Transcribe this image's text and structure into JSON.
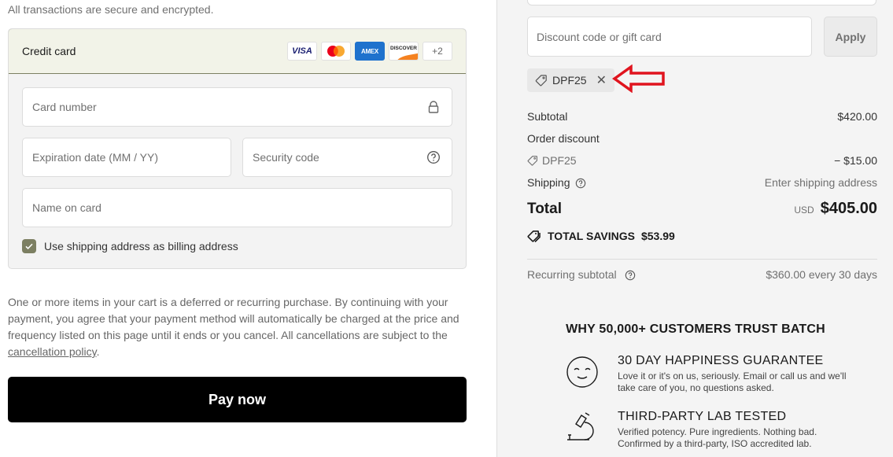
{
  "payment": {
    "secure_note": "All transactions are secure and encrypted.",
    "method_label": "Credit card",
    "card_brands": [
      "VISA",
      "Mastercard",
      "AMEX",
      "DISCOVER"
    ],
    "more_brands": "+2",
    "fields": {
      "card_number_placeholder": "Card number",
      "expiration_placeholder": "Expiration date (MM / YY)",
      "security_code_placeholder": "Security code",
      "name_placeholder": "Name on card"
    },
    "billing_checkbox_label": "Use shipping address as billing address",
    "billing_checkbox_checked": true,
    "accent_color": "#7c7f62"
  },
  "legal": {
    "text": "One or more items in your cart is a deferred or recurring purchase. By continuing with your payment, you agree that your payment method will automatically be charged at the price and frequency listed on this page until it ends or you cancel. All cancellations are subject to the ",
    "link": "cancellation policy",
    "suffix": "."
  },
  "pay_button": "Pay now",
  "summary": {
    "discount_placeholder": "Discount code or gift card",
    "apply_label": "Apply",
    "applied_code": "DPF25",
    "subtotal_label": "Subtotal",
    "subtotal_value": "$420.00",
    "order_discount_label": "Order discount",
    "discount_code": "DPF25",
    "discount_value": "− $15.00",
    "shipping_label": "Shipping",
    "shipping_value": "Enter shipping address",
    "total_label": "Total",
    "currency": "USD",
    "total_value": "$405.00",
    "savings_label": "TOTAL SAVINGS",
    "savings_value": "$53.99",
    "recurring_label": "Recurring subtotal",
    "recurring_value": "$360.00 every 30 days"
  },
  "trust": {
    "title": "WHY 50,000+ CUSTOMERS TRUST BATCH",
    "items": [
      {
        "icon": "smiley-face-icon",
        "heading": "30 DAY HAPPINESS GUARANTEE",
        "text": "Love it or it's on us, seriously. Email or call us and we'll take care of you, no questions asked."
      },
      {
        "icon": "microscope-icon",
        "heading": "THIRD-PARTY LAB TESTED",
        "text": "Verified potency. Pure ingredients. Nothing bad. Confirmed by a third-party, ISO accredited lab."
      }
    ]
  },
  "annotation": {
    "arrow_color": "#e0141e"
  }
}
